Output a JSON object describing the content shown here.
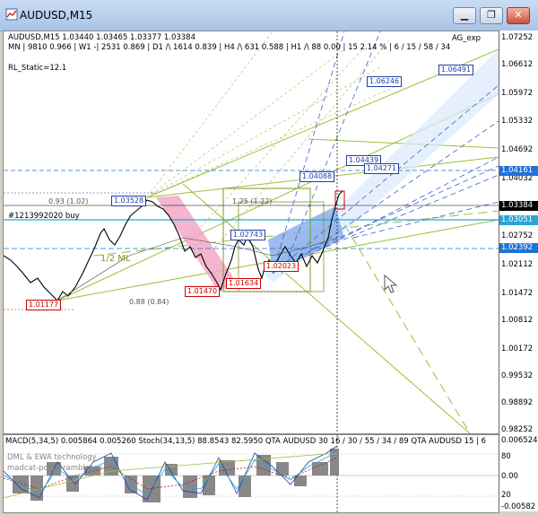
{
  "window": {
    "title": "AUDUSD,M15",
    "controls": {
      "minimize": "▁",
      "restore": "❐",
      "close": "✕"
    }
  },
  "info_line1": "AUDUSD,M15  1.03440 1.03465 1.03377 1.03384",
  "info_line2": "MN | 9810  0.966 | W1 -| 2531  0.869 | D1 /\\ 1614  0.839 | H4 /\\ 631  0.588 | H1 /\\ 88  0.00 | 15  2.14 % | 6 / 15 / 58 / 34",
  "indicator_label": "RL_Static=12.1",
  "ag_label": "AG_exp",
  "order_line": "#1213992020 buy",
  "ml_label": "1/2 ML",
  "price_axis": [
    {
      "value": "1.07252"
    },
    {
      "value": "1.06612"
    },
    {
      "value": "1.05972"
    },
    {
      "value": "1.05332"
    },
    {
      "value": "1.04692"
    },
    {
      "value": "1.04032"
    },
    {
      "value": "1.03384"
    },
    {
      "value": "1.02752"
    },
    {
      "value": "1.02112"
    },
    {
      "value": "1.01472"
    },
    {
      "value": "1.00812"
    },
    {
      "value": "1.00172"
    },
    {
      "value": "0.99532"
    },
    {
      "value": "0.98892"
    },
    {
      "value": "0.98252"
    }
  ],
  "price_tags": [
    {
      "value": "1.04161",
      "color": "#1e73d6"
    },
    {
      "value": "1.03384",
      "color": "#000000"
    },
    {
      "value": "1.03051",
      "color": "#2aa6d6"
    },
    {
      "value": "1.02392",
      "color": "#1e73d6"
    }
  ],
  "level_boxes_blue": [
    "1.06491",
    "1.06246",
    "1.04439",
    "1.04271",
    "1.04088",
    "1.03528",
    "1.02743"
  ],
  "level_boxes_red": [
    "1.01470",
    "1.01177",
    "1.01634",
    "1.02023"
  ],
  "ratio_labels": [
    "0.93 (1.02)",
    "0.88 (0.84)",
    "1.25 (1.22)"
  ],
  "macd": {
    "header": "MACD(5,34,5)  0.005864  0.005260  Stoch(34,13,5)  88.8543  82.5950  QTA AUDUSD 30  16 / 30 / 55 / 34 / 89  QTA AUDUSD 15 | 6",
    "watermark1": "DML & EWA  technology",
    "watermark2": "madcat-post@rambler.ru",
    "axis": [
      "0.006524",
      "80",
      "0.00",
      "20",
      "-0.00582"
    ]
  }
}
